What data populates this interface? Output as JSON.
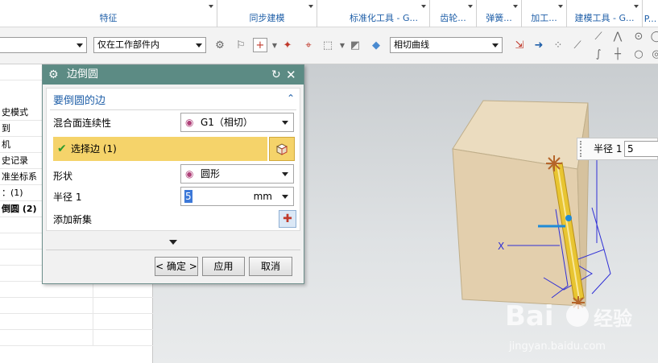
{
  "ribbon": {
    "groups": [
      "特征",
      "同步建模",
      "标准化工具 - G...",
      "齿轮...",
      "弹簧...",
      "加工...",
      "建模工具 - G...",
      "P..."
    ]
  },
  "toolbar": {
    "filter_value": "",
    "scope_value": "仅在工作部件内",
    "curve_rule_value": "相切曲线"
  },
  "navigator": {
    "rows": [
      {
        "label": "",
        "bold": false
      },
      {
        "label": "史模式",
        "bold": false
      },
      {
        "label": "到",
        "bold": false
      },
      {
        "label": "机",
        "bold": false
      },
      {
        "label": "史记录",
        "bold": false
      },
      {
        "label": "准坐标系",
        "bold": false
      },
      {
        "label": "：(1)",
        "bold": false
      },
      {
        "label": "倒圆 (2)",
        "bold": true
      },
      {
        "label": "",
        "bold": false
      },
      {
        "label": "",
        "bold": false
      },
      {
        "label": "",
        "bold": false
      },
      {
        "label": "",
        "bold": false
      },
      {
        "label": "",
        "bold": false
      },
      {
        "label": "",
        "bold": false
      },
      {
        "label": "",
        "bold": false
      },
      {
        "label": "",
        "bold": false
      }
    ]
  },
  "dialog": {
    "title": "边倒圆",
    "section_title": "要倒圆的边",
    "continuity_label": "混合面连续性",
    "continuity_value": "G1（相切）",
    "select_edge_label": "选择边 (1)",
    "shape_label": "形状",
    "shape_value": "圆形",
    "radius_label": "半径 1",
    "radius_value": "5",
    "radius_unit": "mm",
    "add_set_label": "添加新集",
    "ok_label": "< 确定 >",
    "apply_label": "应用",
    "cancel_label": "取消"
  },
  "viewport": {
    "radius_label": "半径 1",
    "radius_value": "5",
    "axis_label": "X"
  },
  "colors": {
    "dialog_title_bg": "#5c8b84",
    "selection_highlight": "#f5d36a",
    "section_text": "#1f5fa8",
    "block_face": "#e3cfad",
    "fillet_edge": "#e8c532"
  }
}
